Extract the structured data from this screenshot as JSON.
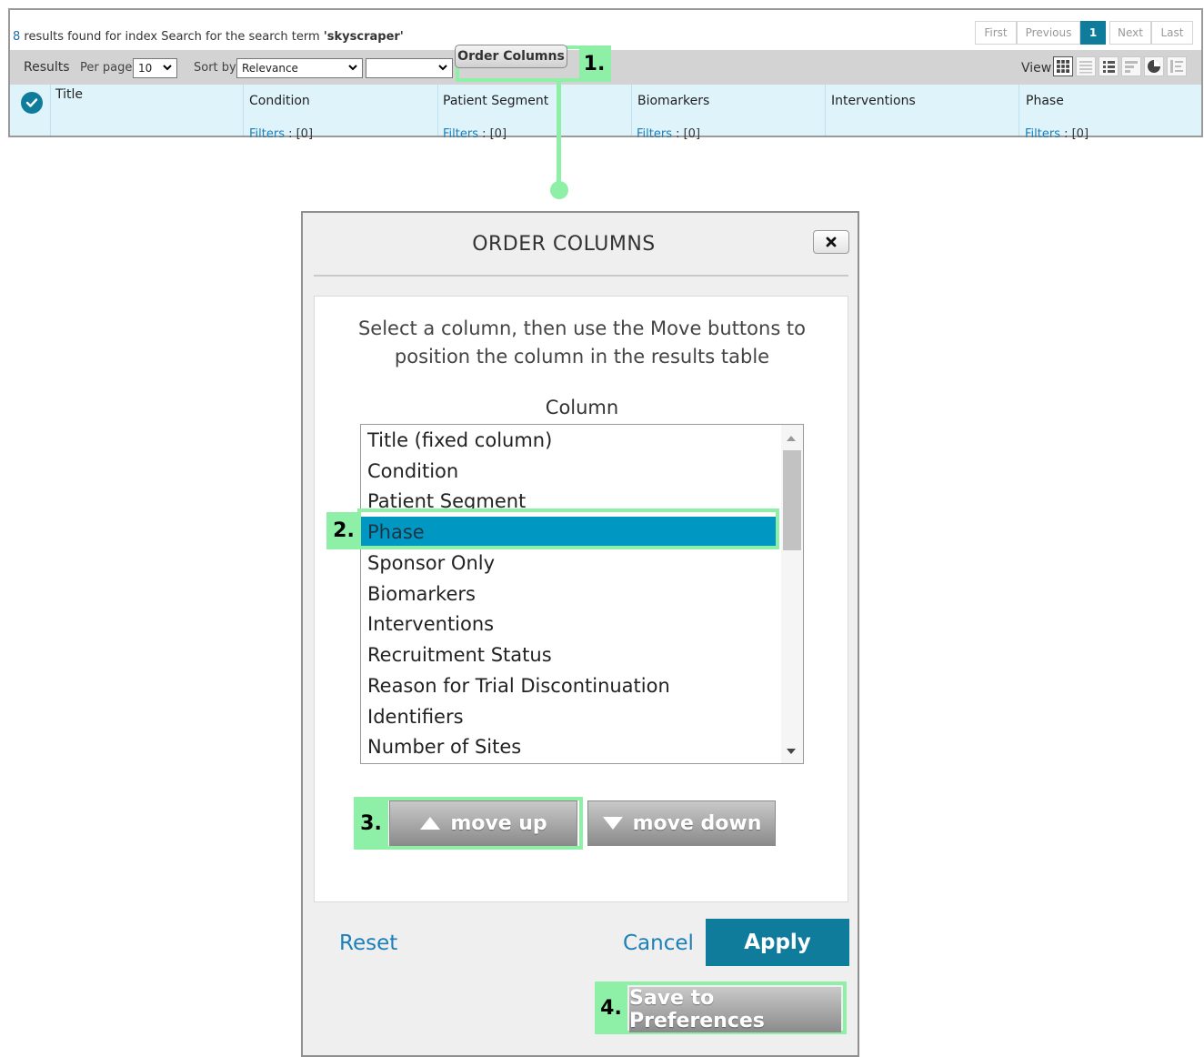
{
  "results": {
    "count": "8",
    "summary_text": " results found for index Search for the search term ",
    "search_term": "'skyscraper'"
  },
  "pagination": {
    "first": "First",
    "previous": "Previous",
    "current_page": "1",
    "next": "Next",
    "last": "Last"
  },
  "toolbar": {
    "results_label": "Results",
    "per_page_label": "Per page :",
    "per_page_value": "10",
    "sort_by_label": "Sort by:",
    "sort_by_value": "Relevance",
    "sort_order_value": "",
    "order_columns_label": "Order Columns",
    "view_label": "View"
  },
  "table_columns": [
    {
      "name": "Title",
      "filter_label": "",
      "filter_count": ""
    },
    {
      "name": "Condition",
      "filter_label": "Filters",
      "filter_count": " : [0]"
    },
    {
      "name": "Patient Segment",
      "filter_label": "Filters",
      "filter_count": " : [0]"
    },
    {
      "name": "Biomarkers",
      "filter_label": "Filters",
      "filter_count": " : [0]"
    },
    {
      "name": "Interventions",
      "filter_label": "",
      "filter_count": ""
    },
    {
      "name": "Phase",
      "filter_label": "Filters",
      "filter_count": " : [0]"
    }
  ],
  "callouts": {
    "step1": "1.",
    "step2": "2.",
    "step3": "3.",
    "step4": "4."
  },
  "dialog": {
    "title": "ORDER COLUMNS",
    "instructions": "Select a column, then use the Move buttons to position the column in the results table",
    "column_heading": "Column",
    "columns": [
      "Title (fixed column)",
      "Condition",
      "Patient Segment",
      "Phase",
      "Sponsor Only",
      "Biomarkers",
      "Interventions",
      "Recruitment Status",
      "Reason for Trial Discontinuation",
      "Identifiers",
      "Number of Sites"
    ],
    "selected_column": "Phase",
    "move_up_label": "move up",
    "move_down_label": "move down",
    "reset_label": "Reset",
    "cancel_label": "Cancel",
    "apply_label": "Apply",
    "save_label": "Save to Preferences"
  },
  "colors": {
    "accent": "#0f7c9c",
    "selection": "#0097c2",
    "callout": "#8ef0a6",
    "link": "#1b7fb8"
  }
}
